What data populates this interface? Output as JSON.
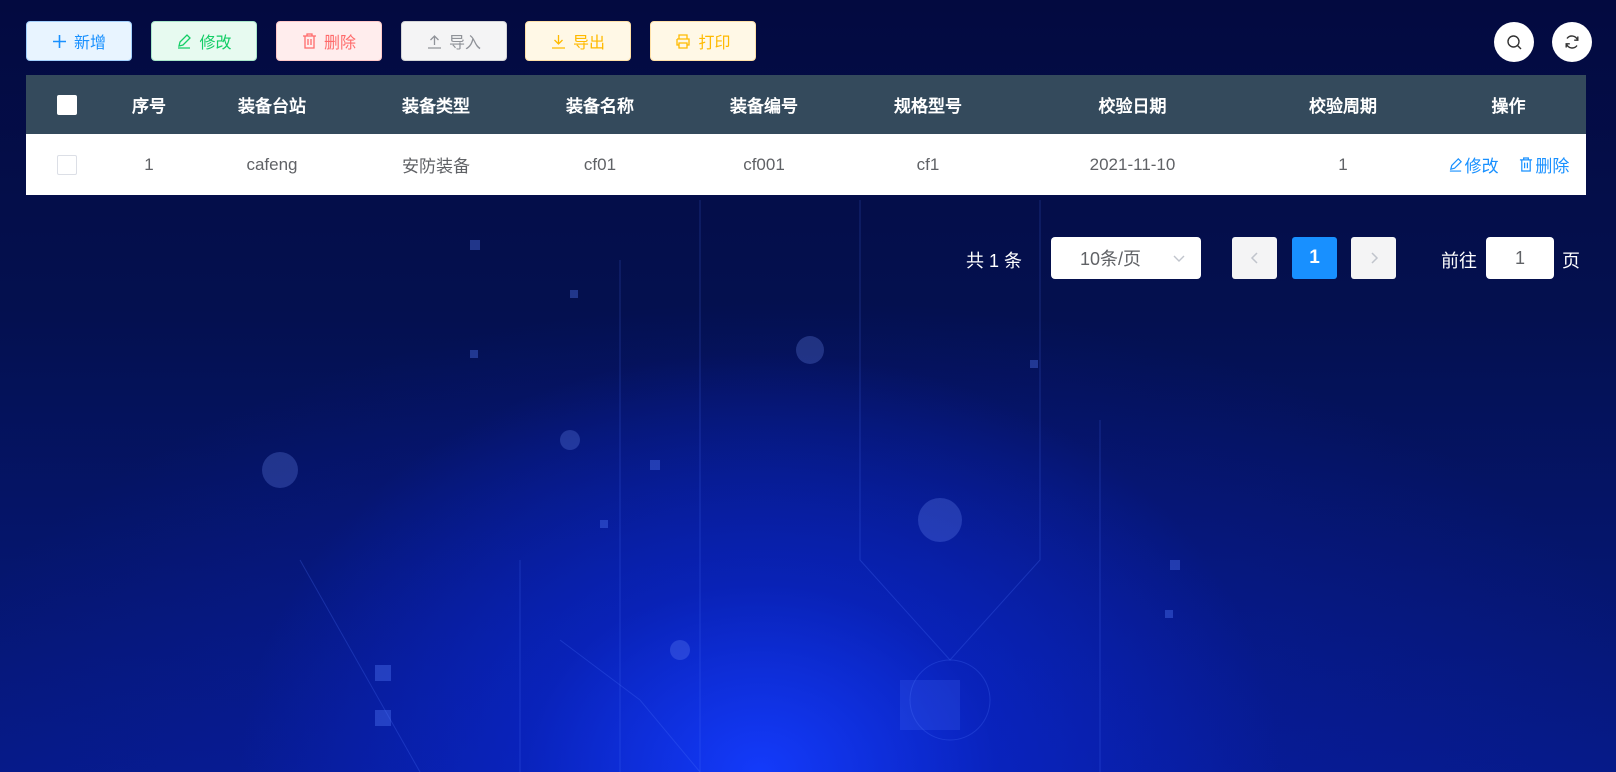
{
  "toolbar": {
    "add_label": "新增",
    "edit_label": "修改",
    "delete_label": "删除",
    "import_label": "导入",
    "export_label": "导出",
    "print_label": "打印"
  },
  "table": {
    "headers": {
      "index": "序号",
      "station": "装备台站",
      "type": "装备类型",
      "name": "装备名称",
      "code": "装备编号",
      "spec": "规格型号",
      "check_date": "校验日期",
      "check_cycle": "校验周期",
      "ops": "操作"
    },
    "rows": [
      {
        "index": "1",
        "station": "cafeng",
        "type": "安防装备",
        "name": "cf01",
        "code": "cf001",
        "spec": "cf1",
        "check_date": "2021-11-10",
        "check_cycle": "1",
        "edit_label": "修改",
        "delete_label": "删除"
      }
    ]
  },
  "pagination": {
    "total_text": "共 1 条",
    "page_size": "10条/页",
    "current_page": "1",
    "goto_label": "前往",
    "goto_value": "1",
    "goto_suffix": "页"
  },
  "colors": {
    "primary": "#1890ff",
    "header_bg": "#344a5c",
    "success": "#13ce66",
    "danger": "#ff6a6a",
    "warning": "#ffba00",
    "info": "#909399"
  },
  "icons": {
    "add": "plus-icon",
    "edit": "edit-icon",
    "delete": "trash-icon",
    "import": "upload-icon",
    "export": "download-icon",
    "print": "printer-icon",
    "search": "search-icon",
    "refresh": "refresh-icon"
  }
}
